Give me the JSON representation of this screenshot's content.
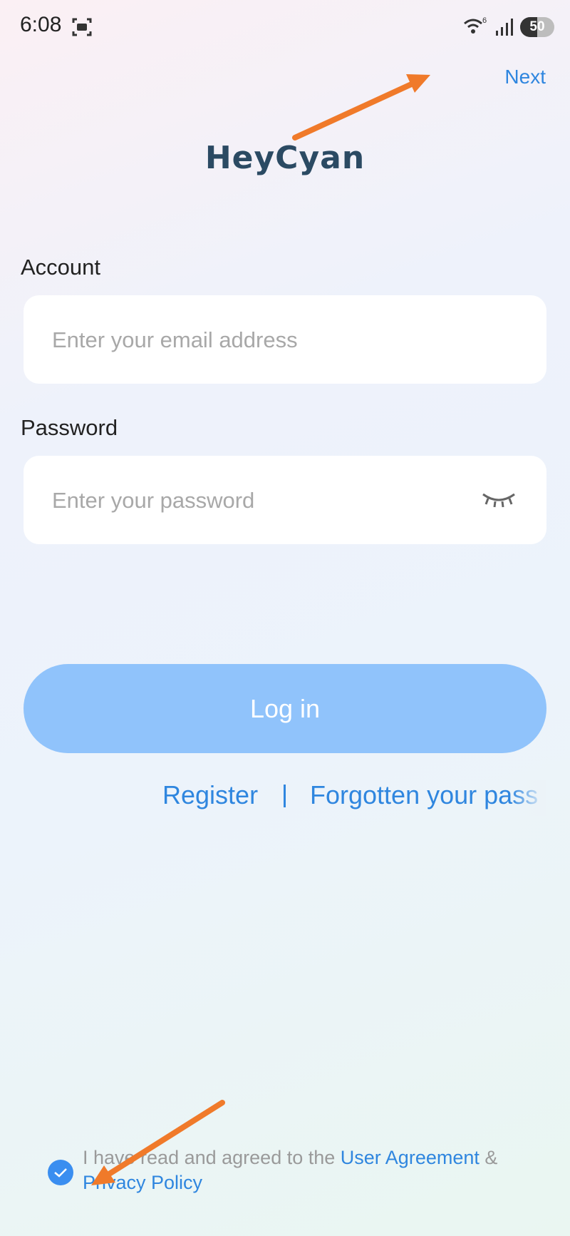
{
  "status_bar": {
    "time": "6:08",
    "wifi_badge": "6",
    "battery_level": "50",
    "icons": [
      "screen-record-icon",
      "wifi-icon",
      "signal-icon",
      "battery-icon"
    ]
  },
  "header": {
    "next_label": "Next",
    "app_title": "HeyCyan"
  },
  "form": {
    "account_label": "Account",
    "account_placeholder": "Enter your email address",
    "account_value": "",
    "password_label": "Password",
    "password_placeholder": "Enter your password",
    "password_value": "",
    "password_toggle_icon": "eye-closed-icon",
    "login_label": "Log in"
  },
  "links": {
    "register_label": "Register",
    "forgot_label": "Forgotten your pass"
  },
  "agreement": {
    "checked": true,
    "text_prefix": "I have read and agreed to the ",
    "user_agreement_label": "User Agreement",
    "joiner": " & ",
    "privacy_policy_label": "Privacy Policy"
  },
  "colors": {
    "accent": "#2f86df",
    "login_button": "#90c3fb",
    "title": "#2b4a63",
    "annotation_arrow": "#f07a2a"
  }
}
